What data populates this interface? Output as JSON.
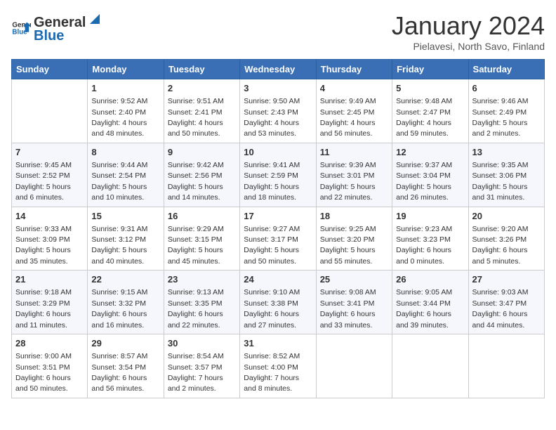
{
  "header": {
    "logo_general": "General",
    "logo_blue": "Blue",
    "month": "January 2024",
    "location": "Pielavesi, North Savo, Finland"
  },
  "days_of_week": [
    "Sunday",
    "Monday",
    "Tuesday",
    "Wednesday",
    "Thursday",
    "Friday",
    "Saturday"
  ],
  "weeks": [
    [
      {
        "day": "",
        "sunrise": "",
        "sunset": "",
        "daylight": ""
      },
      {
        "day": "1",
        "sunrise": "9:52 AM",
        "sunset": "2:40 PM",
        "daylight": "4 hours and 48 minutes."
      },
      {
        "day": "2",
        "sunrise": "9:51 AM",
        "sunset": "2:41 PM",
        "daylight": "4 hours and 50 minutes."
      },
      {
        "day": "3",
        "sunrise": "9:50 AM",
        "sunset": "2:43 PM",
        "daylight": "4 hours and 53 minutes."
      },
      {
        "day": "4",
        "sunrise": "9:49 AM",
        "sunset": "2:45 PM",
        "daylight": "4 hours and 56 minutes."
      },
      {
        "day": "5",
        "sunrise": "9:48 AM",
        "sunset": "2:47 PM",
        "daylight": "4 hours and 59 minutes."
      },
      {
        "day": "6",
        "sunrise": "9:46 AM",
        "sunset": "2:49 PM",
        "daylight": "5 hours and 2 minutes."
      }
    ],
    [
      {
        "day": "7",
        "sunrise": "9:45 AM",
        "sunset": "2:52 PM",
        "daylight": "5 hours and 6 minutes."
      },
      {
        "day": "8",
        "sunrise": "9:44 AM",
        "sunset": "2:54 PM",
        "daylight": "5 hours and 10 minutes."
      },
      {
        "day": "9",
        "sunrise": "9:42 AM",
        "sunset": "2:56 PM",
        "daylight": "5 hours and 14 minutes."
      },
      {
        "day": "10",
        "sunrise": "9:41 AM",
        "sunset": "2:59 PM",
        "daylight": "5 hours and 18 minutes."
      },
      {
        "day": "11",
        "sunrise": "9:39 AM",
        "sunset": "3:01 PM",
        "daylight": "5 hours and 22 minutes."
      },
      {
        "day": "12",
        "sunrise": "9:37 AM",
        "sunset": "3:04 PM",
        "daylight": "5 hours and 26 minutes."
      },
      {
        "day": "13",
        "sunrise": "9:35 AM",
        "sunset": "3:06 PM",
        "daylight": "5 hours and 31 minutes."
      }
    ],
    [
      {
        "day": "14",
        "sunrise": "9:33 AM",
        "sunset": "3:09 PM",
        "daylight": "5 hours and 35 minutes."
      },
      {
        "day": "15",
        "sunrise": "9:31 AM",
        "sunset": "3:12 PM",
        "daylight": "5 hours and 40 minutes."
      },
      {
        "day": "16",
        "sunrise": "9:29 AM",
        "sunset": "3:15 PM",
        "daylight": "5 hours and 45 minutes."
      },
      {
        "day": "17",
        "sunrise": "9:27 AM",
        "sunset": "3:17 PM",
        "daylight": "5 hours and 50 minutes."
      },
      {
        "day": "18",
        "sunrise": "9:25 AM",
        "sunset": "3:20 PM",
        "daylight": "5 hours and 55 minutes."
      },
      {
        "day": "19",
        "sunrise": "9:23 AM",
        "sunset": "3:23 PM",
        "daylight": "6 hours and 0 minutes."
      },
      {
        "day": "20",
        "sunrise": "9:20 AM",
        "sunset": "3:26 PM",
        "daylight": "6 hours and 5 minutes."
      }
    ],
    [
      {
        "day": "21",
        "sunrise": "9:18 AM",
        "sunset": "3:29 PM",
        "daylight": "6 hours and 11 minutes."
      },
      {
        "day": "22",
        "sunrise": "9:15 AM",
        "sunset": "3:32 PM",
        "daylight": "6 hours and 16 minutes."
      },
      {
        "day": "23",
        "sunrise": "9:13 AM",
        "sunset": "3:35 PM",
        "daylight": "6 hours and 22 minutes."
      },
      {
        "day": "24",
        "sunrise": "9:10 AM",
        "sunset": "3:38 PM",
        "daylight": "6 hours and 27 minutes."
      },
      {
        "day": "25",
        "sunrise": "9:08 AM",
        "sunset": "3:41 PM",
        "daylight": "6 hours and 33 minutes."
      },
      {
        "day": "26",
        "sunrise": "9:05 AM",
        "sunset": "3:44 PM",
        "daylight": "6 hours and 39 minutes."
      },
      {
        "day": "27",
        "sunrise": "9:03 AM",
        "sunset": "3:47 PM",
        "daylight": "6 hours and 44 minutes."
      }
    ],
    [
      {
        "day": "28",
        "sunrise": "9:00 AM",
        "sunset": "3:51 PM",
        "daylight": "6 hours and 50 minutes."
      },
      {
        "day": "29",
        "sunrise": "8:57 AM",
        "sunset": "3:54 PM",
        "daylight": "6 hours and 56 minutes."
      },
      {
        "day": "30",
        "sunrise": "8:54 AM",
        "sunset": "3:57 PM",
        "daylight": "7 hours and 2 minutes."
      },
      {
        "day": "31",
        "sunrise": "8:52 AM",
        "sunset": "4:00 PM",
        "daylight": "7 hours and 8 minutes."
      },
      {
        "day": "",
        "sunrise": "",
        "sunset": "",
        "daylight": ""
      },
      {
        "day": "",
        "sunrise": "",
        "sunset": "",
        "daylight": ""
      },
      {
        "day": "",
        "sunrise": "",
        "sunset": "",
        "daylight": ""
      }
    ]
  ]
}
